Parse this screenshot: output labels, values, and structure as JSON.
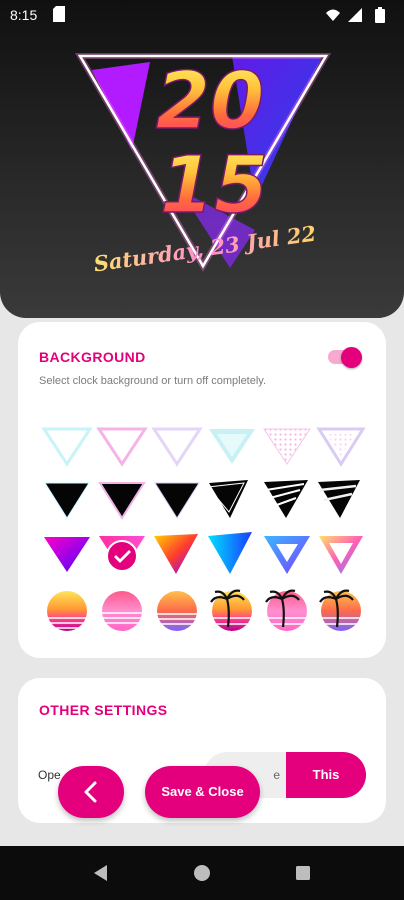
{
  "status_bar": {
    "time": "8:15"
  },
  "preview": {
    "year_top": "20",
    "year_bottom": "15",
    "date": "Saturday, 23 Jul 22"
  },
  "background_section": {
    "title": "BACKGROUND",
    "description": "Select clock background or turn off completely.",
    "enabled": true,
    "selected_option": "gradient-triangle-2"
  },
  "other_section": {
    "title": "OTHER SETTINGS",
    "row_label": "Ope",
    "segment_options": [
      "e",
      "This"
    ],
    "segment_selected": "This"
  },
  "buttons": {
    "save_close": "Save & Close"
  },
  "colors": {
    "accent": "#e4007c",
    "toggle_track": "#f7a9cf"
  },
  "icons": [
    "sd-card-icon",
    "wifi-icon",
    "signal-icon",
    "battery-icon",
    "chevron-left-icon",
    "check-icon",
    "back-nav-icon",
    "home-nav-icon",
    "recents-nav-icon"
  ]
}
